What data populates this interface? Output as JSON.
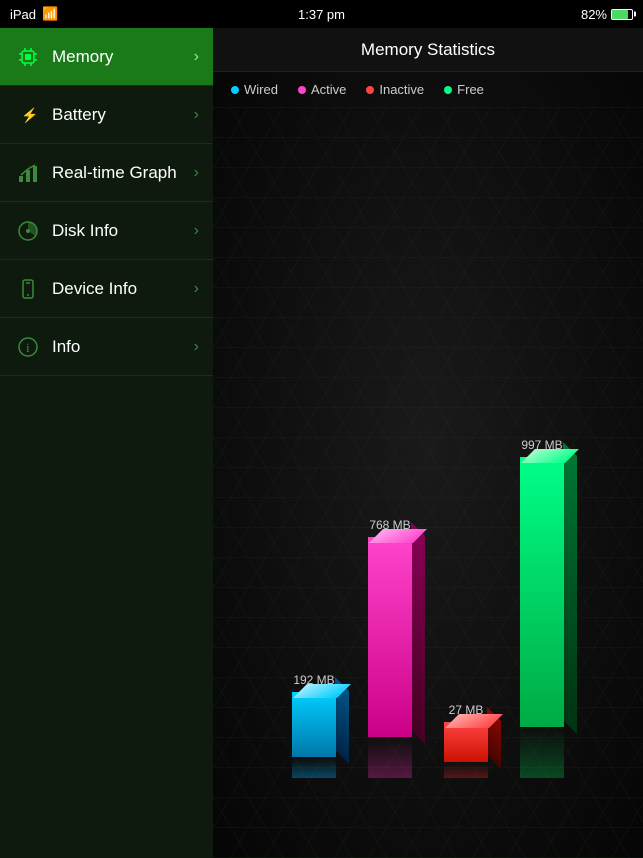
{
  "statusBar": {
    "deviceName": "iPad",
    "time": "1:37 pm",
    "batteryPercent": "82%",
    "batteryLevel": 82
  },
  "sidebar": {
    "items": [
      {
        "id": "memory",
        "label": "Memory",
        "icon": "chip-icon",
        "active": true
      },
      {
        "id": "battery",
        "label": "Battery",
        "icon": "battery-icon",
        "active": false
      },
      {
        "id": "realtime-graph",
        "label": "Real-time Graph",
        "icon": "graph-icon",
        "active": false
      },
      {
        "id": "disk-info",
        "label": "Disk Info",
        "icon": "disk-icon",
        "active": false
      },
      {
        "id": "device-info",
        "label": "Device Info",
        "icon": "device-icon",
        "active": false
      },
      {
        "id": "info",
        "label": "Info",
        "icon": "info-icon",
        "active": false
      }
    ]
  },
  "main": {
    "title": "Memory Statistics",
    "legend": [
      {
        "id": "wired",
        "label": "Wired",
        "color": "#00ccff"
      },
      {
        "id": "active",
        "label": "Active",
        "color": "#ff44cc"
      },
      {
        "id": "inactive",
        "label": "Inactive",
        "color": "#ff4444"
      },
      {
        "id": "free",
        "label": "Free",
        "color": "#00ff88"
      }
    ],
    "bars": [
      {
        "id": "wired",
        "label": "192 MB",
        "type": "wired"
      },
      {
        "id": "active",
        "label": "768 MB",
        "type": "active"
      },
      {
        "id": "inactive",
        "label": "27 MB",
        "type": "inactive"
      },
      {
        "id": "free",
        "label": "997 MB",
        "type": "free"
      }
    ]
  }
}
